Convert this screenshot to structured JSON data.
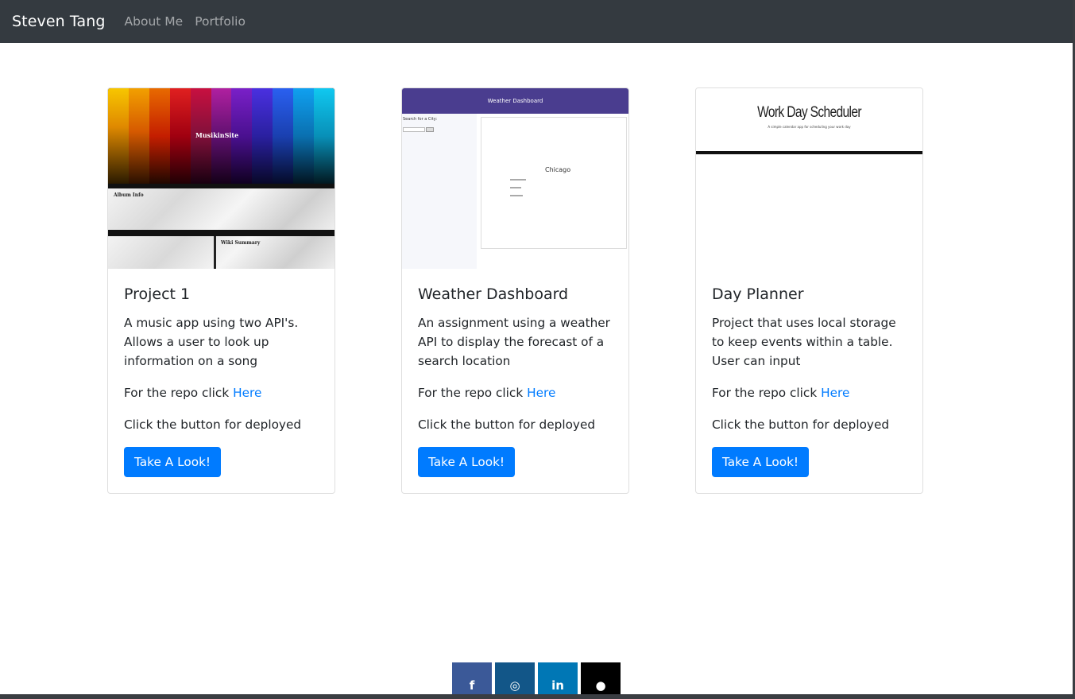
{
  "navbar": {
    "brand": "Steven Tang",
    "links": [
      "About Me",
      "Portfolio"
    ]
  },
  "cards": [
    {
      "title": "Project 1",
      "description": "A music app using two API's. Allows a user to look up information on a song",
      "repo_prefix": "For the repo click",
      "repo_link": "Here",
      "deploy_text": "Click the button for deployed",
      "button": "Take A Look!",
      "thumbnail": {
        "site_title": "MusikinSite",
        "panel_1": "Album Info",
        "panel_2": "Wiki Summary"
      }
    },
    {
      "title": "Weather Dashboard",
      "description": "An assignment using a weather API to display the forecast of a search location",
      "repo_prefix": "For the repo click",
      "repo_link": "Here",
      "deploy_text": "Click the button for deployed",
      "button": "Take A Look!",
      "thumbnail": {
        "header": "Weather Dashboard",
        "search_label": "Search for a City:",
        "city": "Chicago"
      }
    },
    {
      "title": "Day Planner",
      "description": "Project that uses local storage to keep events within a table. User can input",
      "repo_prefix": "For the repo click",
      "repo_link": "Here",
      "deploy_text": "Click the button for deployed",
      "button": "Take A Look!",
      "thumbnail": {
        "title": "Work Day Scheduler",
        "subtitle": "A simple calendar app for scheduling your work day"
      }
    }
  ],
  "social": [
    {
      "name": "facebook-icon",
      "glyph": "f",
      "color": "#3b5998"
    },
    {
      "name": "instagram-icon",
      "glyph": "◎",
      "color": "#125688"
    },
    {
      "name": "linkedin-icon",
      "glyph": "in",
      "color": "#0077b5"
    },
    {
      "name": "github-icon",
      "glyph": "●",
      "color": "#000000"
    }
  ],
  "colors": {
    "navbar": "#343a40",
    "primary": "#007bff",
    "link": "#007bff"
  }
}
